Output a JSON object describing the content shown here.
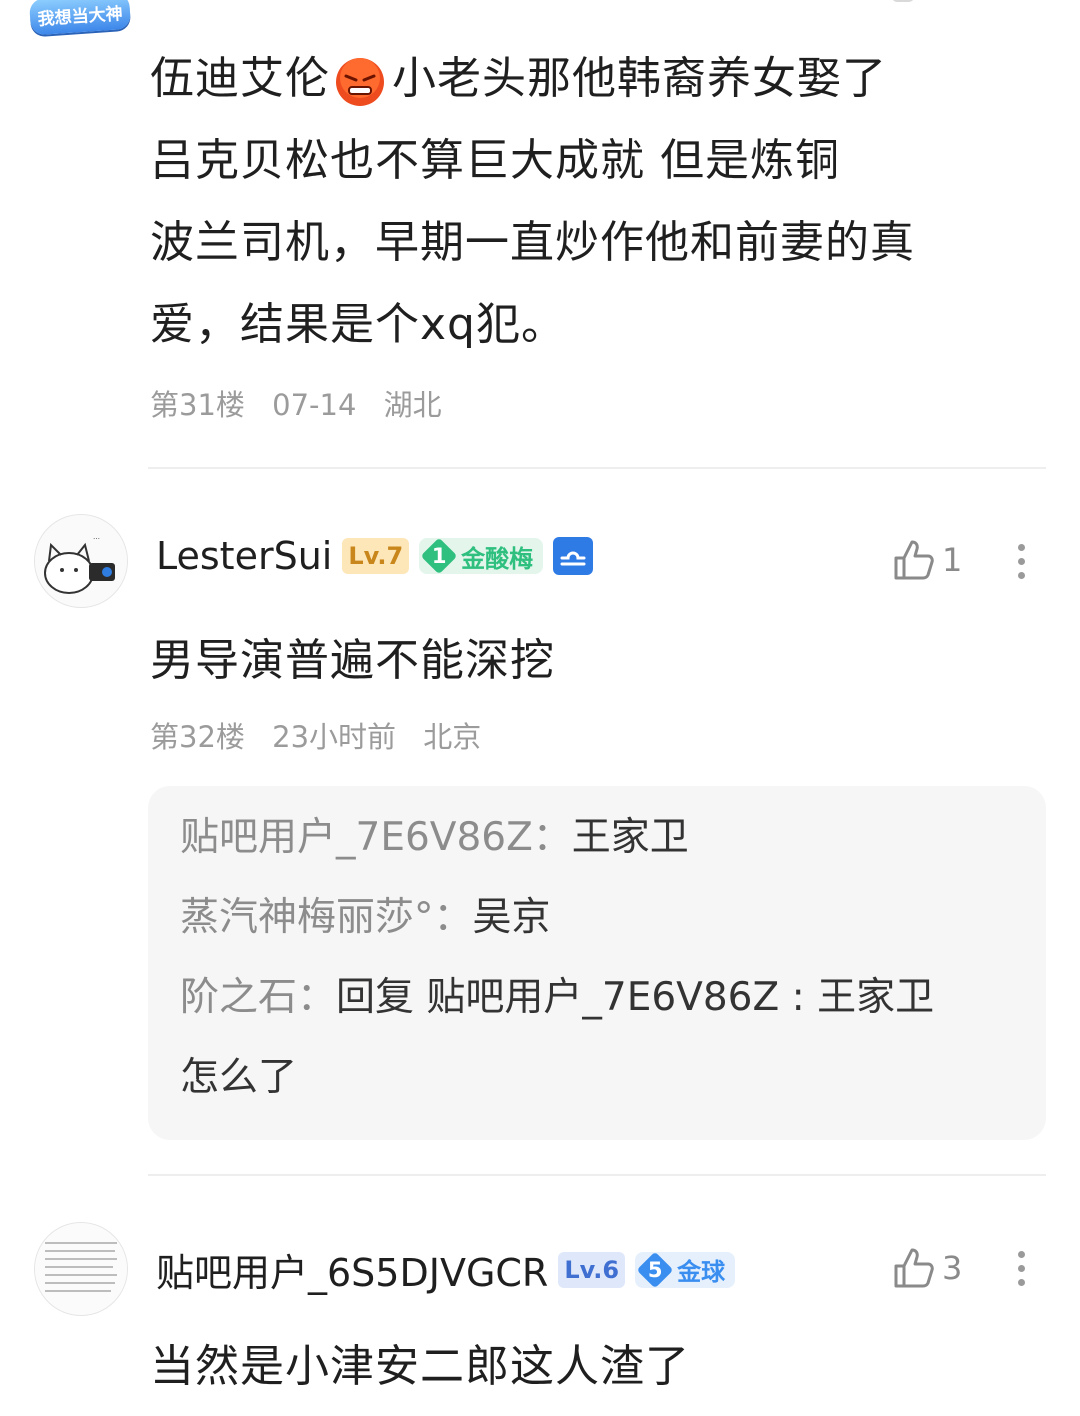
{
  "top_badge": "我想当大神",
  "comment31": {
    "lines": [
      [
        "伍迪艾伦 ",
        "小老头那他韩裔养女娶了"
      ],
      [
        "吕克贝松也不算巨大成就 但是炼铜"
      ],
      [
        "波兰司机，早期一直炒作他和前妻的真"
      ],
      [
        "爱，结果是个xq犯。"
      ]
    ],
    "emoji": "angry-face-emoji",
    "floor": "第31楼",
    "date": "07-14",
    "location": "湖北"
  },
  "comment32": {
    "username": "LesterSui",
    "level": "Lv.7",
    "tag_num": "1",
    "tag": "金酸梅",
    "zodiac_icon": "libra-icon",
    "likes": "1",
    "text": "男导演普遍不能深挖",
    "floor": "第32楼",
    "time": "23小时前",
    "location": "北京",
    "replies": [
      {
        "user": "贴吧用户_7E6V86Z：",
        "text": "王家卫"
      },
      {
        "user": "蒸汽神梅丽莎°：",
        "text": "吴京"
      },
      {
        "user": "阶之石：",
        "text": "回复 贴吧用户_7E6V86Z : 王家卫"
      },
      {
        "user": "",
        "text": "怎么了"
      }
    ]
  },
  "comment33": {
    "username": "贴吧用户_6S5DJVGCR",
    "level": "Lv.6",
    "tag_num": "5",
    "tag": "金球",
    "likes": "3",
    "text": "当然是小津安二郎这人渣了"
  },
  "colors": {
    "lv7_bg": "#fde6b8",
    "lv7_fg": "#c9861a",
    "lv6_bg": "#dfe8fb",
    "lv6_fg": "#3f6fd1",
    "tag_green": "#2fbf7f",
    "tag_blue": "#3a8ef0"
  }
}
